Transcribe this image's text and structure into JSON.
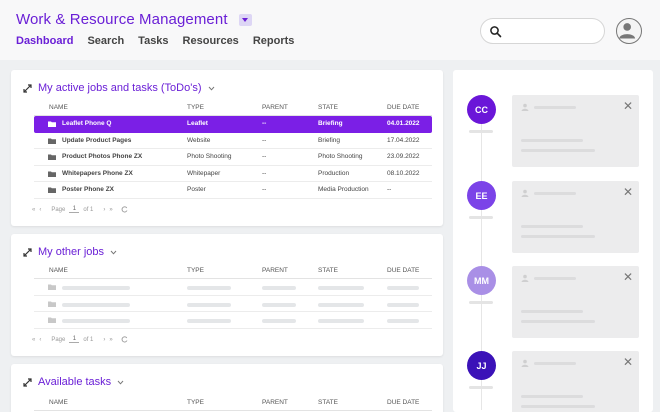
{
  "header": {
    "title": "Work & Resource Management",
    "nav": [
      "Dashboard",
      "Search",
      "Tasks",
      "Resources",
      "Reports"
    ],
    "active_nav": "Dashboard"
  },
  "columns": {
    "name": "NAME",
    "type": "TYPE",
    "parent": "PARENT",
    "state": "STATE",
    "due": "DUE DATE"
  },
  "panels": {
    "active": {
      "title": "My active jobs and tasks (ToDo's)",
      "rows": [
        {
          "name": "Leaflet Phone Q",
          "type": "Leaflet",
          "parent": "--",
          "state": "Briefing",
          "due": "04.01.2022",
          "selected": true
        },
        {
          "name": "Update Product Pages",
          "type": "Website",
          "parent": "--",
          "state": "Briefing",
          "due": "17.04.2022"
        },
        {
          "name": "Product Photos Phone ZX",
          "type": "Photo Shooting",
          "parent": "--",
          "state": "Photo Shooting",
          "due": "23.09.2022"
        },
        {
          "name": "Whitepapers Phone ZX",
          "type": "Whitepaper",
          "parent": "--",
          "state": "Production",
          "due": "08.10.2022"
        },
        {
          "name": "Poster Phone ZX",
          "type": "Poster",
          "parent": "--",
          "state": "Media Production",
          "due": "--"
        }
      ],
      "pager": {
        "first": "«",
        "prev": "‹",
        "page_label": "Page",
        "page": "1",
        "of_label": "of 1",
        "next": "›",
        "last": "»"
      }
    },
    "other": {
      "title": "My other jobs",
      "pager": {
        "first": "«",
        "prev": "‹",
        "page_label": "Page",
        "page": "1",
        "of_label": "of 1",
        "next": "›",
        "last": "»"
      }
    },
    "available": {
      "title": "Available tasks"
    }
  },
  "timeline": {
    "entries": [
      {
        "initials": "CC",
        "color": "#6a16d8"
      },
      {
        "initials": "EE",
        "color": "#7b43e8"
      },
      {
        "initials": "MM",
        "color": "#a98fe6"
      },
      {
        "initials": "JJ",
        "color": "#3b12b8"
      }
    ]
  },
  "colors": {
    "accent": "#6a1fd6",
    "selected_row": "#7b1fe6"
  }
}
